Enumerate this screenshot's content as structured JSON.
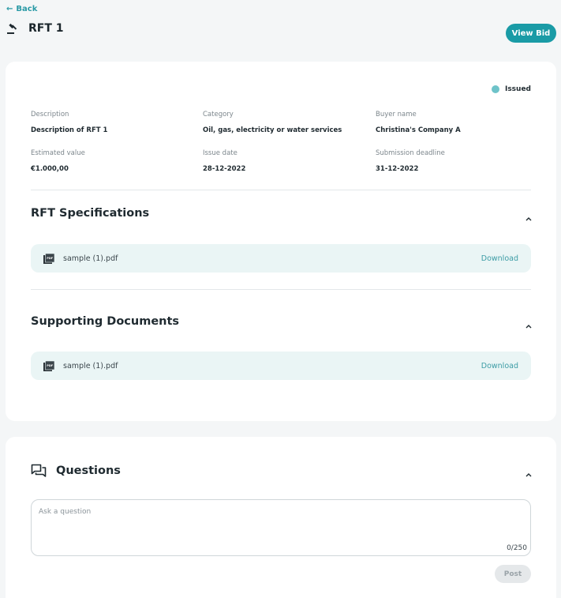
{
  "nav": {
    "back_label": "Back"
  },
  "header": {
    "title": "RFT 1",
    "view_bid_label": "View Bid"
  },
  "status": {
    "label": "Issued",
    "color": "#6ec3c9"
  },
  "details": {
    "description_label": "Description",
    "description_value": "Description of RFT 1",
    "category_label": "Category",
    "category_value": "Oil, gas, electricity or water services",
    "buyer_label": "Buyer name",
    "buyer_value": "Christina's Company A",
    "estimated_label": "Estimated value",
    "estimated_value": "€1.000,00",
    "issue_label": "Issue date",
    "issue_value": "28-12-2022",
    "deadline_label": "Submission deadline",
    "deadline_value": "31-12-2022"
  },
  "specifications": {
    "title": "RFT Specifications",
    "file_name": "sample (1).pdf",
    "download_label": "Download"
  },
  "supporting": {
    "title": "Supporting Documents",
    "file_name": "sample (1).pdf",
    "download_label": "Download"
  },
  "questions": {
    "title": "Questions",
    "placeholder": "Ask a question",
    "counter": "0/250",
    "post_label": "Post"
  },
  "colors": {
    "accent": "#1a9ba6",
    "file_row_bg": "#eaf5f5",
    "download_link": "#3c9ca5"
  }
}
